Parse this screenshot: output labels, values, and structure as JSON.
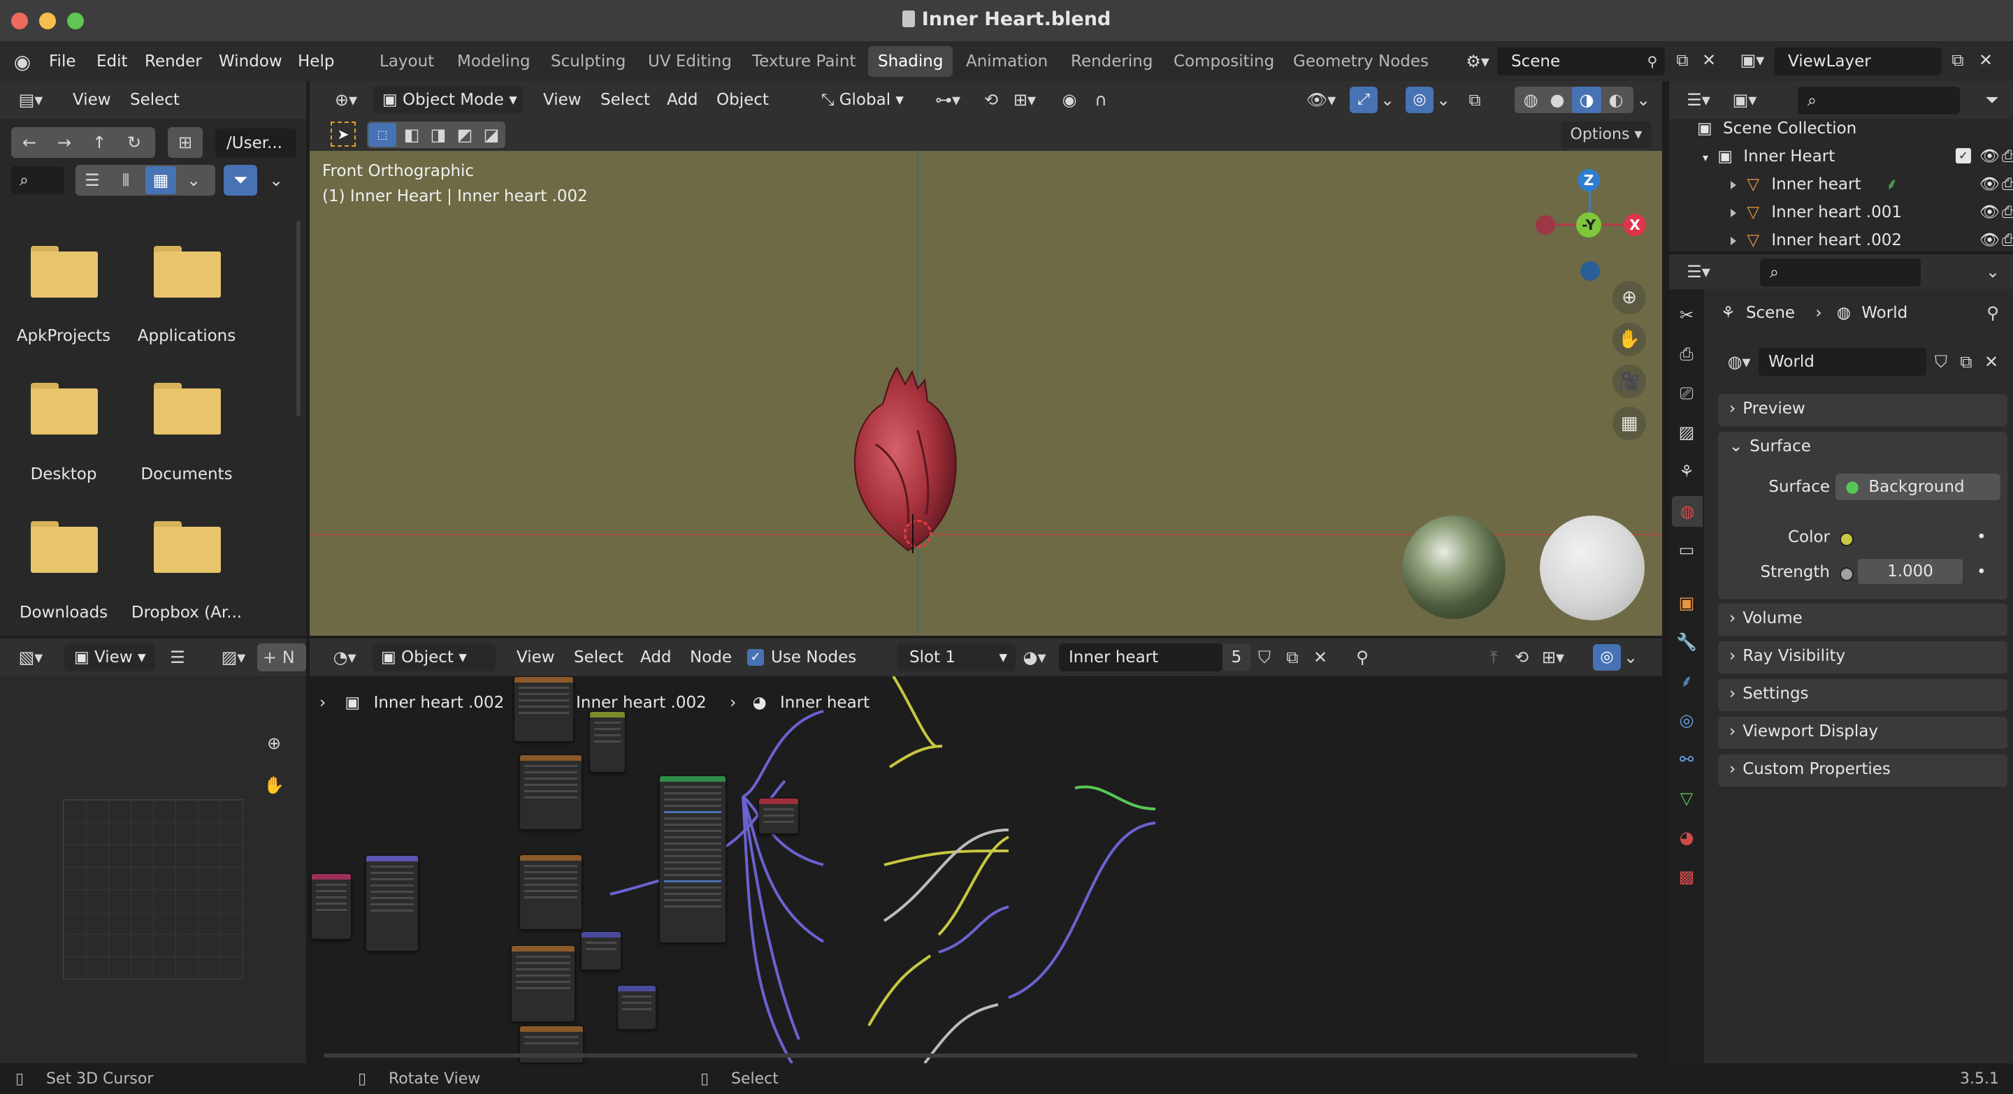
{
  "window": {
    "title": "Inner Heart.blend"
  },
  "menu": [
    "File",
    "Edit",
    "Render",
    "Window",
    "Help"
  ],
  "workspaces": [
    "Layout",
    "Modeling",
    "Sculpting",
    "UV Editing",
    "Texture Paint",
    "Shading",
    "Animation",
    "Rendering",
    "Compositing",
    "Geometry Nodes"
  ],
  "active_workspace": "Shading",
  "scene": {
    "label": "Scene",
    "viewlayer": "ViewLayer"
  },
  "filebrowser": {
    "menu": [
      "View",
      "Select"
    ],
    "path": "/User...",
    "items": [
      "ApkProjects",
      "Applications",
      "Desktop",
      "Documents",
      "Downloads",
      "Dropbox (Ar..."
    ]
  },
  "viewport": {
    "mode": "Object Mode",
    "menu": [
      "View",
      "Select",
      "Add",
      "Object"
    ],
    "orientation": "Global",
    "options": "Options",
    "overlay_line1": "Front Orthographic",
    "overlay_line2": "(1) Inner Heart | Inner heart .002",
    "gizmo": {
      "z": "Z",
      "y": "-Y",
      "x": "X"
    }
  },
  "nodeeditor": {
    "mode": "Object",
    "menu": [
      "View",
      "Select",
      "Add",
      "Node"
    ],
    "use_nodes": "Use Nodes",
    "slot": "Slot 1",
    "material": "Inner heart",
    "users": "5",
    "breadcrumb": [
      "Inner heart .002",
      "Inner heart .002",
      "Inner heart"
    ]
  },
  "imageeditor": {
    "view": "View"
  },
  "outliner": {
    "root": "Scene Collection",
    "collection": "Inner Heart",
    "items": [
      "Inner heart",
      "Inner heart .001",
      "Inner heart .002"
    ]
  },
  "properties": {
    "breadcrumb": [
      "Scene",
      "World"
    ],
    "world": "World",
    "panels": [
      "Preview",
      "Surface",
      "Volume",
      "Ray Visibility",
      "Settings",
      "Viewport Display",
      "Custom Properties"
    ],
    "surface_label": "Surface",
    "surface_value": "Background",
    "color_label": "Color",
    "strength_label": "Strength",
    "strength_value": "1.000"
  },
  "status": {
    "left": "Set 3D Cursor",
    "middle": "Rotate View",
    "right": "Select",
    "version": "3.5.1"
  },
  "colors": {
    "accent": "#4772b3",
    "viewport_bg": "#6d6a45",
    "folder": "#e8c46c"
  }
}
